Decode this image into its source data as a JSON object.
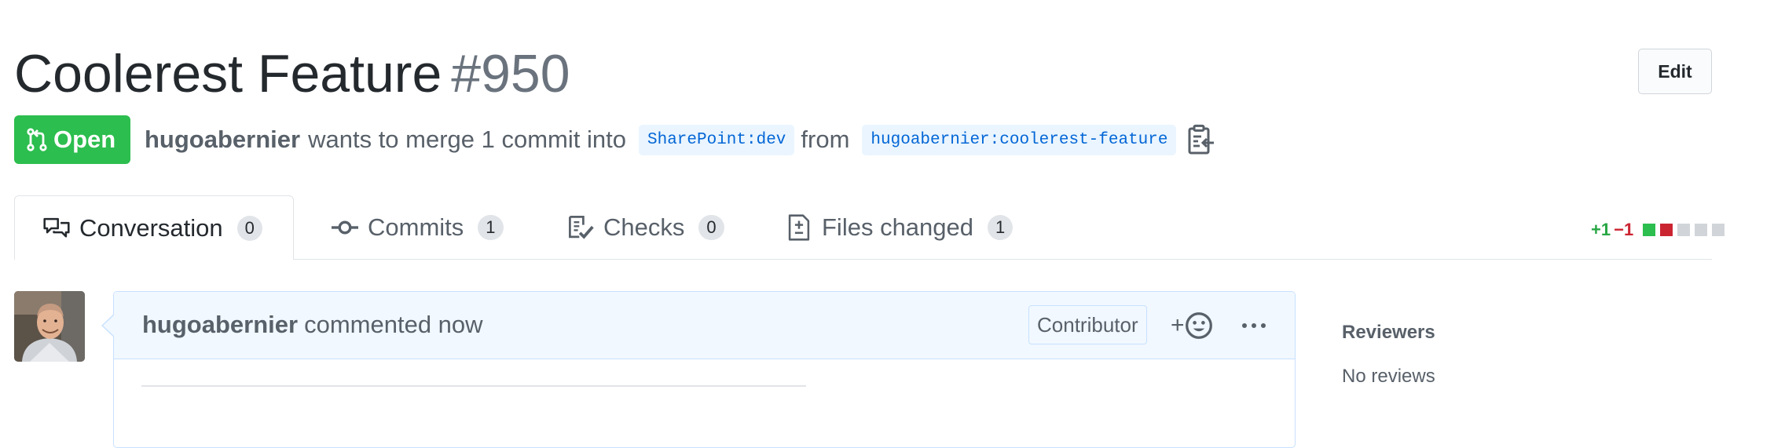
{
  "pull_request": {
    "title": "Coolerest Feature",
    "number": "#950",
    "edit_label": "Edit",
    "state": "Open",
    "author": "hugoabernier",
    "merge_text": "wants to merge 1 commit into",
    "base_branch": "SharePoint:dev",
    "from_text": "from",
    "head_branch": "hugoabernier:coolerest-feature"
  },
  "tabs": [
    {
      "label": "Conversation",
      "count": "0",
      "icon": "comment-discussion-icon"
    },
    {
      "label": "Commits",
      "count": "1",
      "icon": "git-commit-icon"
    },
    {
      "label": "Checks",
      "count": "0",
      "icon": "checklist-icon"
    },
    {
      "label": "Files changed",
      "count": "1",
      "icon": "file-diff-icon"
    }
  ],
  "diffstat": {
    "additions": "+1",
    "deletions": "−1"
  },
  "comment": {
    "author": "hugoabernier",
    "action_text": "commented now",
    "role": "Contributor"
  },
  "sidebar": {
    "reviewers_heading": "Reviewers",
    "reviewers_value": "No reviews"
  },
  "colors": {
    "open_green": "#2cbe4e",
    "link_blue": "#0366d6",
    "addition_green": "#28a745",
    "deletion_red": "#cb2431",
    "header_blue_bg": "#f1f8ff",
    "header_blue_border": "#c8e1ff"
  }
}
